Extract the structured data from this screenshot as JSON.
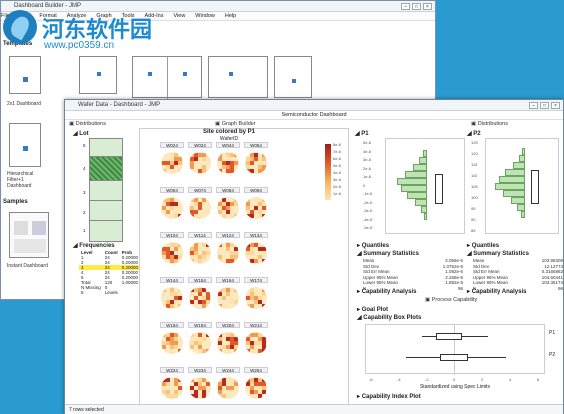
{
  "watermark": {
    "title": "河东软件园",
    "url": "www.pc0359.cn"
  },
  "win1": {
    "title": "Dashboard Builder - JMP",
    "menu": [
      "File",
      "Edit",
      "Format",
      "Analyze",
      "Graph",
      "Tools",
      "Add-Ins",
      "View",
      "Window",
      "Help"
    ],
    "templates_label": "Templates",
    "thumb1_label": "2x1 Dashboard",
    "thumb2_label": "Hierarchical Filter+1 Dashboard",
    "samples_label": "Samples",
    "sample1_label": "Instant Dashboard"
  },
  "win2": {
    "title": "Wafer Data - Dashboard - JMP",
    "subtitle": "Semiconductor Dashboard",
    "distributions": "Distributions",
    "graph_builder": "Graph Builder",
    "lot": "Lot",
    "frequencies": "Frequencies",
    "freq_cols": [
      "Level",
      "Count",
      "Prob"
    ],
    "freq_rows": [
      [
        "1",
        "24",
        "0.20000"
      ],
      [
        "2",
        "24",
        "0.20000"
      ],
      [
        "3",
        "24",
        "0.20000"
      ],
      [
        "4",
        "24",
        "0.20000"
      ],
      [
        "5",
        "24",
        "0.20000"
      ],
      [
        "Total",
        "120",
        "1.00000"
      ],
      [
        "N Missing",
        "0",
        ""
      ],
      [
        "5",
        "Levels",
        ""
      ]
    ],
    "lot_levels": [
      "5",
      "4",
      "3",
      "2",
      "1"
    ],
    "gb_title": "Site colored by P1",
    "gb_xlabel": "WaferID",
    "wafer_ids": [
      "W024",
      "W034",
      "W044",
      "W054",
      "W064",
      "W074",
      "W084",
      "W094",
      "W104",
      "W114",
      "W124",
      "W134",
      "W144",
      "W154",
      "W164",
      "W174",
      "W184",
      "W194",
      "W204",
      "W214",
      "W224",
      "W234",
      "W244",
      "W254"
    ],
    "legend_vals": [
      "8e-6",
      "7e-6",
      "6e-6",
      "5e-6",
      "4e-6",
      "3e-6",
      "2e-6",
      "1e-6"
    ],
    "p1": "P1",
    "p2": "P2",
    "p1_ticks": [
      "5e-6",
      "4e-6",
      "3e-6",
      "2e-6",
      "1e-6",
      "0",
      "-1e-6",
      "-2e-6",
      "-3e-6",
      "-4e-6",
      "-5e-6"
    ],
    "p2_ticks": [
      "125",
      "120",
      "115",
      "110",
      "105",
      "100",
      "95",
      "90",
      "85"
    ],
    "quantiles": "Quantiles",
    "summary": "Summary Statistics",
    "stats_p1": [
      [
        "Mean",
        "2.058e-5"
      ],
      [
        "Std Dev",
        "1.0752e-5"
      ],
      [
        "Std Err Mean",
        "1.082e-6"
      ],
      [
        "Upper 95% Mean",
        "2.268e-5"
      ],
      [
        "Lower 95% Mean",
        "1.892e-5"
      ],
      [
        "N",
        "96"
      ]
    ],
    "stats_p2": [
      [
        "Mean",
        "103.98308"
      ],
      [
        "Std Dev",
        "12.12773"
      ],
      [
        "Std Err Mean",
        "0.3166983"
      ],
      [
        "Upper 95% Mean",
        "104.60441"
      ],
      [
        "Lower 95% Mean",
        "103.36174"
      ],
      [
        "N",
        "96"
      ]
    ],
    "cap": "Capability Analysis",
    "proc_cap": "Process Capability",
    "goal": "Goal Plot",
    "cap_box": "Capability Box Plots",
    "cap_index": "Capability Index Plot",
    "box_labels": [
      "P1",
      "P2"
    ],
    "std_label": "Standardized using Spec Limits",
    "status": "7 rows selected",
    "cap_x": [
      "-6",
      "-4",
      "-2",
      "0",
      "2",
      "4",
      "6"
    ]
  },
  "colors": {
    "desktop": "#2a9bd0",
    "accent": "#3a78c4",
    "hist": "#bfe3b4"
  }
}
